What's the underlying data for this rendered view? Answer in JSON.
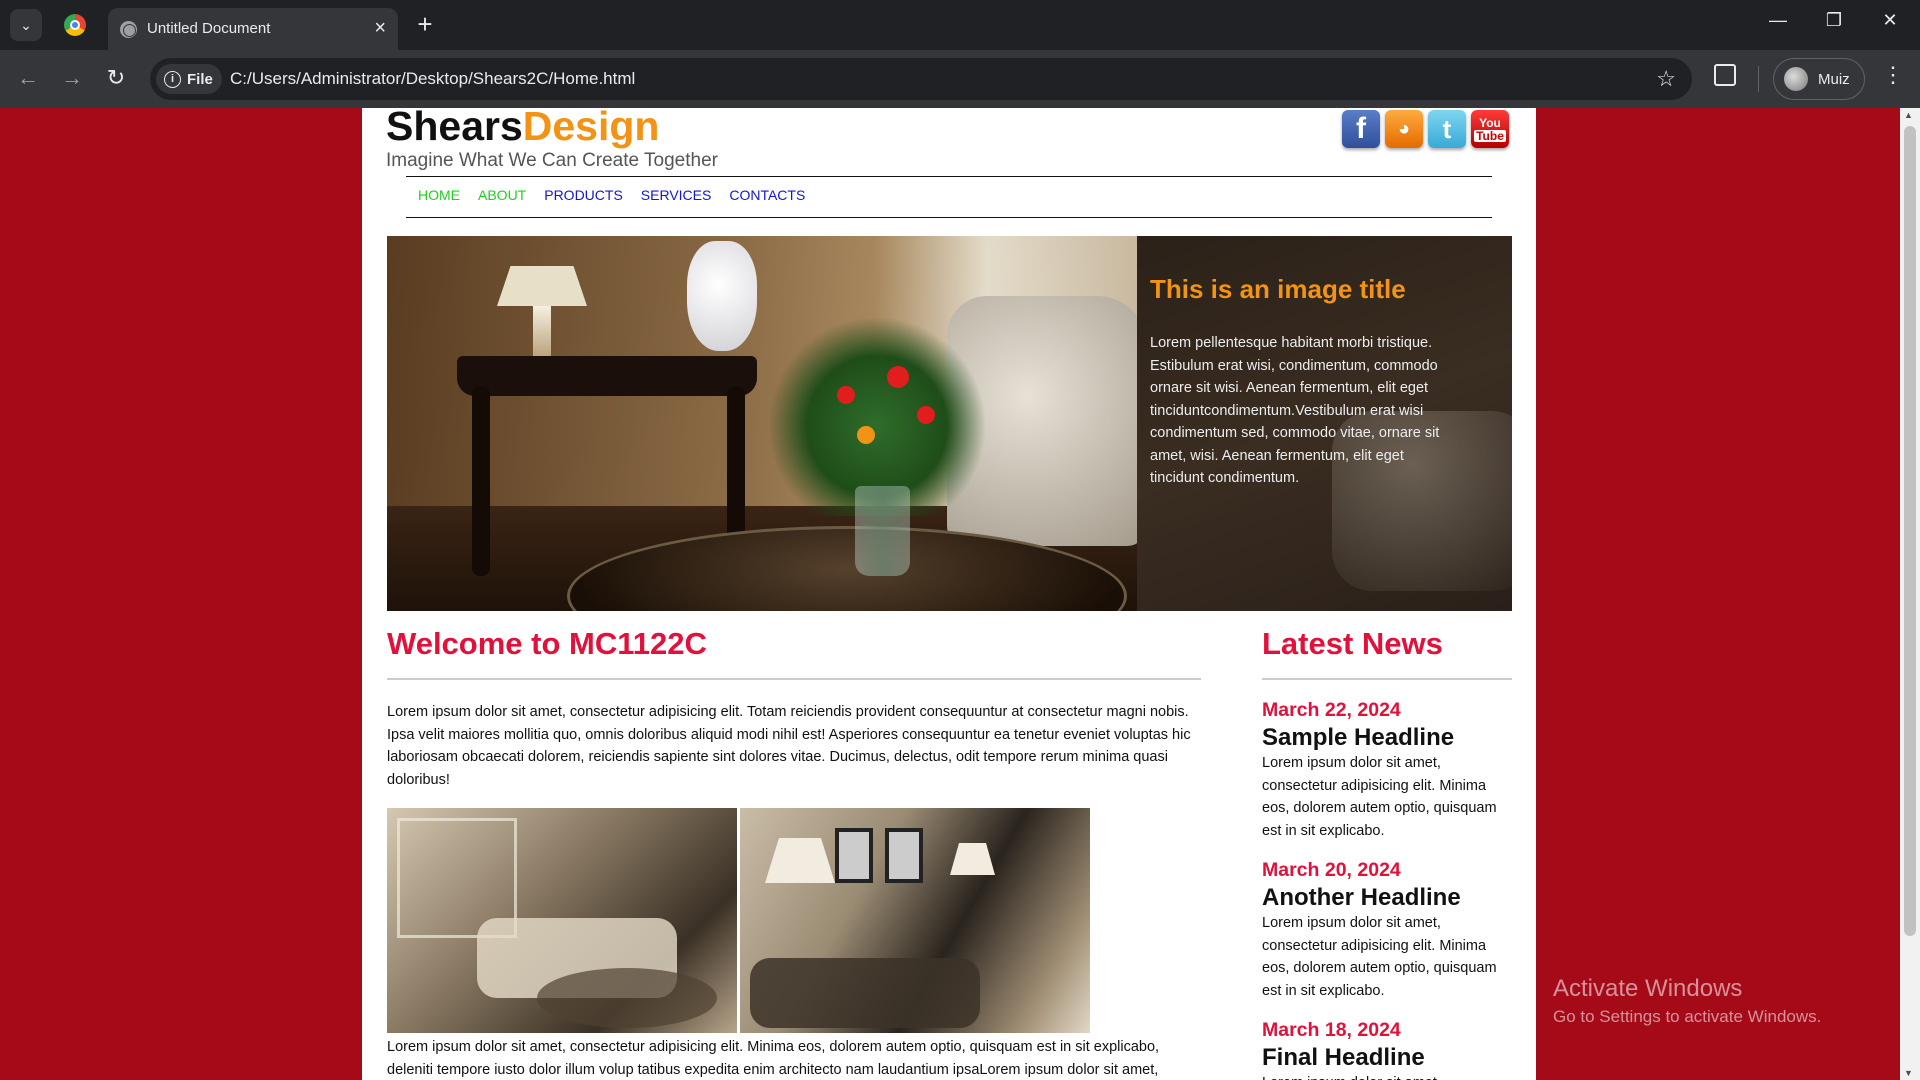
{
  "browser": {
    "tab_title": "Untitled Document",
    "address_chip": "File",
    "url": "C:/Users/Administrator/Desktop/Shears2C/Home.html",
    "profile_name": "Muiz"
  },
  "site": {
    "brand_part1": "Shears",
    "brand_part2": "Design",
    "tagline": "Imagine What We Can Create Together",
    "social": [
      "facebook-icon",
      "rss-icon",
      "twitter-icon",
      "youtube-icon"
    ],
    "nav": [
      {
        "label": "HOME",
        "color": "#1fd11f"
      },
      {
        "label": "ABOUT",
        "color": "#1fd11f"
      },
      {
        "label": "PRODUCTS",
        "color": "#1414d6"
      },
      {
        "label": "SERVICES",
        "color": "#1414d6"
      },
      {
        "label": "CONTACTS",
        "color": "#1414d6"
      }
    ],
    "youtube_label_top": "You",
    "youtube_label_bottom": "Tube"
  },
  "hero": {
    "title": "This is an image title",
    "text": "Lorem pellentesque habitant morbi tristique. Estibulum erat wisi, condimentum, commodo ornare sit wisi. Aenean fermentum, elit eget tinciduntcondimentum.Vestibulum erat wisi condimentum sed, commodo vitae, ornare sit amet, wisi. Aenean fermentum, elit eget tincidunt condimentum."
  },
  "main": {
    "heading": "Welcome to MC1122C",
    "intro": "Lorem ipsum dolor sit amet, consectetur adipisicing elit. Totam reiciendis provident consequuntur at consectetur magni nobis. Ipsa velit maiores mollitia quo, omnis doloribus aliquid modi nihil est! Asperiores consequuntur ea tenetur eveniet voluptas hic laboriosam obcaecati dolorem, reiciendis sapiente sint dolores vitae. Ducimus, delectus, odit tempore rerum minima quasi doloribus!",
    "body": "Lorem ipsum dolor sit amet, consectetur adipisicing elit. Minima eos, dolorem autem optio, quisquam est in sit explicabo, deleniti tempore iusto dolor illum volup tatibus expedita enim architecto nam laudantium ipsaLorem ipsum dolor sit amet,"
  },
  "news": {
    "heading": "Latest News",
    "items": [
      {
        "date": "March 22, 2024",
        "headline": "Sample Headline",
        "text": "Lorem ipsum dolor sit amet, consectetur adipisicing elit. Minima eos, dolorem autem optio, quisquam est in sit explicabo."
      },
      {
        "date": "March 20, 2024",
        "headline": "Another Headline",
        "text": "Lorem ipsum dolor sit amet, consectetur adipisicing elit. Minima eos, dolorem autem optio, quisquam est in sit explicabo."
      },
      {
        "date": "March 18, 2024",
        "headline": "Final Headline",
        "text": "Lorem ipsum dolor sit amet, consectetur adipisicing elit."
      }
    ]
  },
  "watermark": {
    "line1": "Activate Windows",
    "line2": "Go to Settings to activate Windows."
  },
  "colors": {
    "page_background": "#a50a18",
    "accent_red": "#e0113b",
    "accent_orange": "#f29316"
  }
}
